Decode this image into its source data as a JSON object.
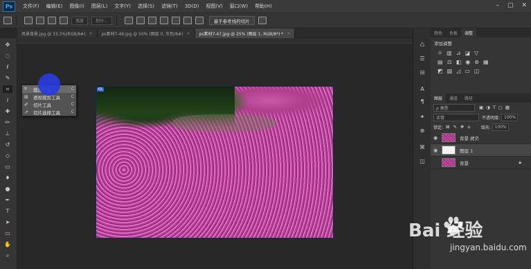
{
  "app": {
    "logo": "Ps",
    "menus": [
      "文件(F)",
      "编辑(E)",
      "图像(I)",
      "图层(L)",
      "文字(Y)",
      "选择(S)",
      "滤镜(T)",
      "3D(D)",
      "视图(V)",
      "窗口(W)",
      "帮助(H)"
    ]
  },
  "options_bar": {
    "field1": "宽度",
    "field2": "划分...",
    "auto_slice_button": "基于参考线的切片"
  },
  "tabs": [
    {
      "label": "风景背景.jpg @ 33.3%(RGB/8#)",
      "close": "×"
    },
    {
      "label": "ps素材7-48.jpg @ 50% (图层 0, 灰色/8#)",
      "close": "×"
    },
    {
      "label": "ps素材7-47.jpg @ 25% (图层 1, RGB/8*) *",
      "close": "×"
    }
  ],
  "flyout": {
    "items": [
      {
        "label": "裁剪工具",
        "key": "C"
      },
      {
        "label": "透视裁剪工具",
        "key": "C"
      },
      {
        "label": "切片工具",
        "key": "C"
      },
      {
        "label": "切片选择工具",
        "key": "C"
      }
    ]
  },
  "slice_badge": "01",
  "panels": {
    "top_tabs": [
      "颜色",
      "色板",
      "调整"
    ],
    "adjust_title": "添加调整",
    "layer_tabs": [
      "图层",
      "通道",
      "路径"
    ],
    "kind_label": "ρ 类型",
    "blend_mode": "正常",
    "opacity_label": "不透明度:",
    "opacity_value": "100%",
    "lock_label": "锁定:",
    "fill_label": "填充:",
    "fill_value": "100%",
    "layers": [
      {
        "name": "背景 拷贝",
        "visible": true,
        "thumb": "flowers"
      },
      {
        "name": "图层 1",
        "visible": true,
        "thumb": "blank",
        "active": true
      },
      {
        "name": "背景",
        "visible": false,
        "thumb": "flowers",
        "locked": true
      }
    ]
  },
  "watermark": {
    "brand": "Bai 经验",
    "url": "jingyan.baidu.com"
  }
}
